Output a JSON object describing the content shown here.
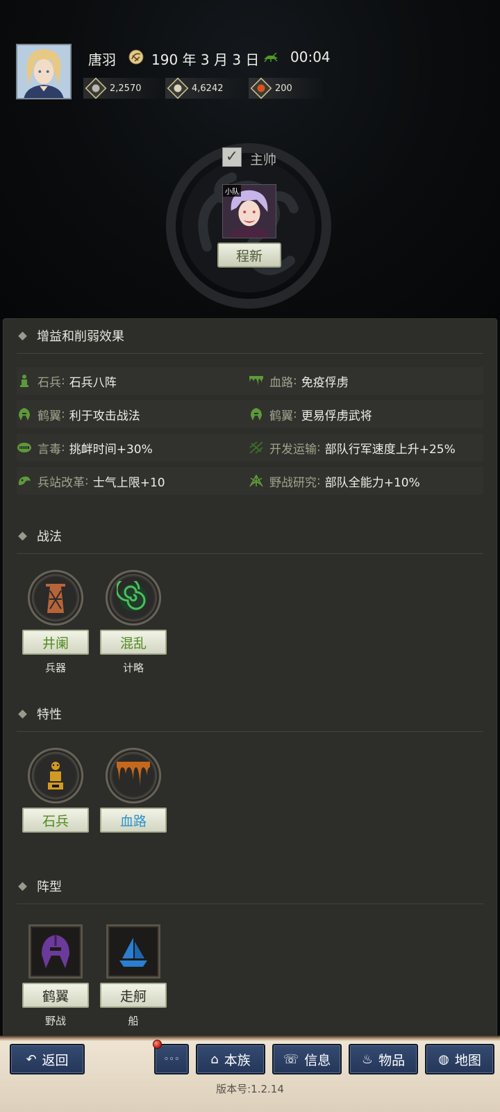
{
  "header": {
    "player_name": "唐羽",
    "date": "190 年 3 月 3 日",
    "time": "00:04",
    "resources": [
      {
        "icon": "silver-coin-icon",
        "value": "2,2570",
        "color": "#b9b9b3"
      },
      {
        "icon": "rice-bowl-icon",
        "value": "4,6242",
        "color": "#d8d3c0"
      },
      {
        "icon": "orange-orb-icon",
        "value": "200",
        "color": "#d8541f"
      }
    ]
  },
  "commander": {
    "checkbox_label": "主帅",
    "checked": true,
    "unit_tag": "小队",
    "general_name": "程新"
  },
  "effects": {
    "title": "增益和削弱效果",
    "items": [
      {
        "key": "石兵",
        "value": "石兵八阵",
        "icon": "stone-soldier-icon"
      },
      {
        "key": "血路",
        "value": "免疫俘虏",
        "icon": "blood-drip-icon"
      },
      {
        "key": "鹤翼",
        "value": "利于攻击战法",
        "icon": "helmet-icon"
      },
      {
        "key": "鹤翼",
        "value": "更易俘虏武将",
        "icon": "helmet-icon"
      },
      {
        "key": "言毒",
        "value": "挑衅时间+30%",
        "icon": "toxic-mouth-icon"
      },
      {
        "key": "开发运输",
        "value": "部队行军速度上升+25%",
        "icon": "transport-icon"
      },
      {
        "key": "兵站改革",
        "value": "士气上限+10",
        "icon": "supply-depot-icon"
      },
      {
        "key": "野战研究",
        "value": "部队全能力+10%",
        "icon": "field-research-icon"
      }
    ]
  },
  "tactics": {
    "title": "战法",
    "items": [
      {
        "name": "井阑",
        "type": "兵器",
        "icon": "siege-tower-icon"
      },
      {
        "name": "混乱",
        "type": "计略",
        "icon": "spiral-icon"
      }
    ]
  },
  "traits": {
    "title": "特性",
    "items": [
      {
        "name": "石兵",
        "icon": "stone-soldier-icon"
      },
      {
        "name": "血路",
        "icon": "blood-drip-icon"
      }
    ]
  },
  "formations": {
    "title": "阵型",
    "items": [
      {
        "name": "鹤翼",
        "type": "野战",
        "icon": "helmet-icon"
      },
      {
        "name": "走舸",
        "type": "船",
        "icon": "sailboat-icon"
      }
    ]
  },
  "nav": {
    "back": "返回",
    "more": "◦◦◦",
    "clan": "本族",
    "info": "信息",
    "items": "物品",
    "map": "地图"
  },
  "version": "版本号:1.2.14"
}
